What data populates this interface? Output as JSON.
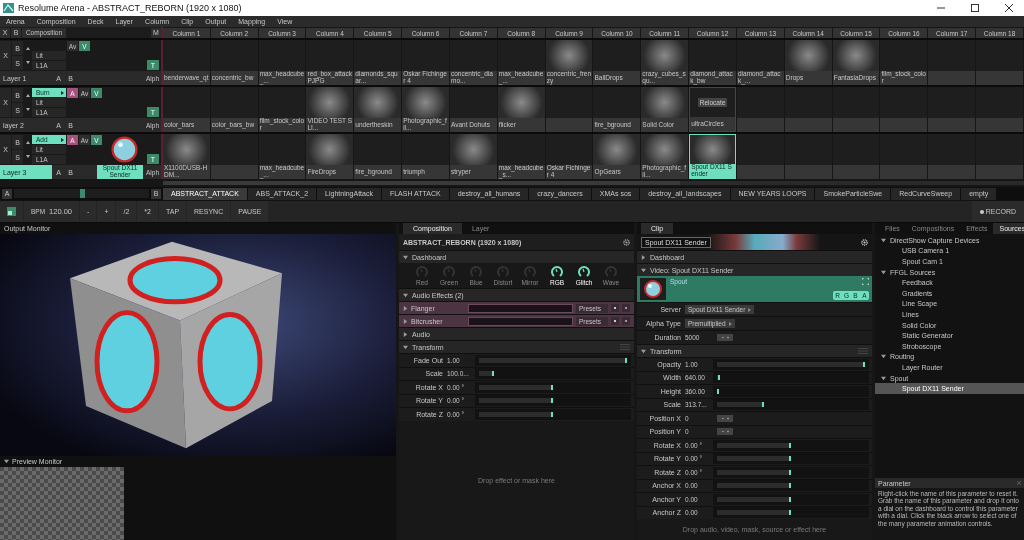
{
  "window": {
    "title": "Resolume Arena - ABSTRACT_REBORN (1920 x 1080)"
  },
  "menu": [
    "Arena",
    "Composition",
    "Deck",
    "Layer",
    "Column",
    "Clip",
    "Output",
    "Mapping",
    "View"
  ],
  "layer_header": {
    "x": "X",
    "b": "B",
    "label": "Composition",
    "m": "M"
  },
  "columns": [
    "Column 1",
    "Column 2",
    "Column 3",
    "Column 4",
    "Column 5",
    "Column 6",
    "Column 7",
    "Column 8",
    "Column 9",
    "Column 10",
    "Column 11",
    "Column 12",
    "Column 13",
    "Column 14",
    "Column 15",
    "Column 16",
    "Column 17",
    "Column 18"
  ],
  "layers": [
    {
      "name": "Layer 1",
      "selected": false,
      "x": "X",
      "b": "B",
      "s": "S",
      "modes": [
        "Lit",
        "L1A"
      ],
      "toggles": [
        {
          "label": "Av",
          "kind": "plain"
        },
        {
          "label": "V",
          "kind": "green"
        }
      ],
      "t": "T",
      "deck_a": "A",
      "deck_b": "B",
      "alpha": "Alph",
      "clips": [
        {
          "name": "benderwave_qt",
          "thumb": false,
          "selected": false,
          "missing": false
        },
        {
          "name": "concentric_bw",
          "thumb": false,
          "selected": false,
          "missing": false
        },
        {
          "name": "max_headcube_...",
          "thumb": false,
          "selected": false,
          "missing": false
        },
        {
          "name": "red_box_attackPJPG",
          "thumb": false,
          "selected": false,
          "missing": false
        },
        {
          "name": "diamonds_squar...",
          "thumb": false,
          "selected": false,
          "missing": false
        },
        {
          "name": "Oskar Fichinger 4",
          "thumb": false,
          "selected": false,
          "missing": false
        },
        {
          "name": "concentric_diamo...",
          "thumb": false,
          "selected": false,
          "missing": false
        },
        {
          "name": "max_headcube_...",
          "thumb": false,
          "selected": false,
          "missing": false
        },
        {
          "name": "concentric_frenzy",
          "thumb": true,
          "selected": false,
          "missing": false
        },
        {
          "name": "BallDrops",
          "thumb": false,
          "selected": false,
          "missing": false
        },
        {
          "name": "crazy_cubes_squ...",
          "thumb": true,
          "selected": false,
          "missing": false
        },
        {
          "name": "diamond_attack_bw",
          "thumb": false,
          "selected": false,
          "missing": false
        },
        {
          "name": "diamond_attack_...",
          "thumb": false,
          "selected": false,
          "missing": false
        },
        {
          "name": "Drops",
          "thumb": true,
          "selected": false,
          "missing": false
        },
        {
          "name": "FantasiaDrops",
          "thumb": true,
          "selected": false,
          "missing": false
        },
        {
          "name": "film_stock_color",
          "thumb": false,
          "selected": false,
          "missing": false
        },
        {
          "thumb": false,
          "selected": false,
          "missing": false
        },
        {
          "thumb": false,
          "selected": false,
          "missing": false
        }
      ]
    },
    {
      "name": "layer 2",
      "selected": false,
      "x": "X",
      "b": "B",
      "s": "S",
      "blend": "Burn",
      "modes": [
        "Lit",
        "L1A"
      ],
      "toggles": [
        {
          "label": "A",
          "kind": "pink"
        },
        {
          "label": "Av",
          "kind": "plain"
        },
        {
          "label": "V",
          "kind": "green"
        }
      ],
      "t": "T",
      "deck_a": "A",
      "deck_b": "B",
      "alpha": "Alph",
      "clips": [
        {
          "name": "color_bars",
          "thumb": false,
          "selected": false,
          "missing": false
        },
        {
          "name": "color_bars_bw",
          "thumb": false,
          "selected": false,
          "missing": false
        },
        {
          "name": "film_stock_color",
          "thumb": false,
          "selected": false,
          "missing": false
        },
        {
          "name": "VIDEO TEST SLI...",
          "thumb": true,
          "selected": false,
          "missing": false
        },
        {
          "name": "undertheskin",
          "thumb": true,
          "selected": false,
          "missing": false
        },
        {
          "name": "Photographic_fil...",
          "thumb": true,
          "selected": false,
          "missing": false
        },
        {
          "name": "Avant Dohuts",
          "thumb": false,
          "selected": false,
          "missing": false
        },
        {
          "name": "flicker",
          "thumb": true,
          "selected": false,
          "missing": false
        },
        {
          "thumb": false,
          "selected": false,
          "missing": false
        },
        {
          "name": "fire_bground",
          "thumb": false,
          "selected": false,
          "missing": false
        },
        {
          "name": "Solid Color",
          "thumb": true,
          "selected": false,
          "missing": false
        },
        {
          "name": "ultraCircles",
          "thumb": false,
          "selected": false,
          "missing": true,
          "action": "Relocate"
        },
        {
          "thumb": false,
          "selected": false,
          "missing": false
        },
        {
          "thumb": false,
          "selected": false,
          "missing": false
        },
        {
          "thumb": false,
          "selected": false,
          "missing": false
        },
        {
          "thumb": false,
          "selected": false,
          "missing": false
        },
        {
          "thumb": false,
          "selected": false,
          "missing": false
        },
        {
          "thumb": false,
          "selected": false,
          "missing": false
        }
      ]
    },
    {
      "name": "Layer 3",
      "selected": true,
      "x": "X",
      "b": "B",
      "s": "S",
      "blend": "Add",
      "modes": [
        "Lit",
        "L1A"
      ],
      "toggles": [
        {
          "label": "A",
          "kind": "pink"
        },
        {
          "label": "Av",
          "kind": "plain"
        },
        {
          "label": "V",
          "kind": "green"
        }
      ],
      "t": "T",
      "deck_a": "A",
      "deck_b": "B",
      "alpha": "Alph",
      "preview": {
        "label": "Spout DX11 Sender"
      },
      "clips": [
        {
          "name": "X1100DUSB-HDM...",
          "thumb": true,
          "selected": false,
          "missing": false
        },
        {
          "thumb": false,
          "selected": false,
          "missing": false
        },
        {
          "name": "max_headcube_...",
          "thumb": false,
          "selected": false,
          "missing": false
        },
        {
          "name": "FireDrops",
          "thumb": true,
          "selected": false,
          "missing": false
        },
        {
          "name": "fire_bground",
          "thumb": false,
          "selected": false,
          "missing": false
        },
        {
          "name": "triumph",
          "thumb": false,
          "selected": false,
          "missing": false
        },
        {
          "name": "stryper",
          "thumb": true,
          "selected": false,
          "missing": false
        },
        {
          "name": "max_headcube_s...",
          "thumb": false,
          "selected": false,
          "missing": false
        },
        {
          "name": "Oskar Fichinger 4",
          "thumb": false,
          "selected": false,
          "missing": false
        },
        {
          "name": "OpGears",
          "thumb": true,
          "selected": false,
          "missing": false
        },
        {
          "name": "Photographic_fil...",
          "thumb": true,
          "selected": false,
          "missing": false
        },
        {
          "name": "Spout DX11 Sender",
          "thumb": true,
          "selected": true,
          "missing": false
        },
        {
          "thumb": false,
          "selected": false,
          "missing": false
        },
        {
          "thumb": false,
          "selected": false,
          "missing": false
        },
        {
          "thumb": false,
          "selected": false,
          "missing": false
        },
        {
          "thumb": false,
          "selected": false,
          "missing": false
        },
        {
          "thumb": false,
          "selected": false,
          "missing": false
        },
        {
          "thumb": false,
          "selected": false,
          "missing": false
        }
      ]
    }
  ],
  "crossfader": {
    "a": "A",
    "b": "B",
    "level": 0.5
  },
  "decks": [
    {
      "label": "ABSTRACT_ATTACK",
      "selected": true
    },
    {
      "label": "ABS_ATTACK_2",
      "selected": false
    },
    {
      "label": "LightningAttack",
      "selected": false
    },
    {
      "label": "FLASH ATTACK",
      "selected": false
    },
    {
      "label": "destroy_all_humans",
      "selected": false
    },
    {
      "label": "crazy_dancers",
      "selected": false
    },
    {
      "label": "XMAs sos",
      "selected": false
    },
    {
      "label": "destroy_all_landscapes",
      "selected": false
    },
    {
      "label": "NEW YEARS LOOPS",
      "selected": false
    },
    {
      "label": "SmokeParticleSwe",
      "selected": false
    },
    {
      "label": "RedCurveSweep",
      "selected": false
    },
    {
      "label": "empty",
      "selected": false
    }
  ],
  "transport": {
    "bpm_label": "BPM",
    "bpm": "120.00",
    "buttons": [
      "-",
      "+",
      "/2",
      "*2",
      "TAP",
      "RESYNC",
      "PAUSE"
    ],
    "record": "RECORD"
  },
  "output_monitor": {
    "title": "Output Monitor"
  },
  "preview_monitor": {
    "title": "Preview Monitor"
  },
  "composition_panel": {
    "tabs": [
      {
        "label": "Composition",
        "selected": true
      },
      {
        "label": "Layer",
        "selected": false
      }
    ],
    "title": "ABSTRACT_REBORN (1920 x 1080)",
    "dashboard": {
      "label": "Dashboard",
      "expanded": true,
      "dials": [
        {
          "label": "Red",
          "on": false
        },
        {
          "label": "Green",
          "on": false
        },
        {
          "label": "Blue",
          "on": false
        },
        {
          "label": "Distort",
          "on": false
        },
        {
          "label": "Mirror",
          "on": false
        },
        {
          "label": "RGB",
          "on": true
        },
        {
          "label": "Glitch",
          "on": true
        },
        {
          "label": "Wave",
          "on": false
        }
      ]
    },
    "audio_effects": {
      "label": "Audio Effects (2)",
      "expanded": true,
      "effects": [
        {
          "name": "Flanger",
          "expanded": false,
          "presets": "Presets"
        },
        {
          "name": "Bitcrusher",
          "expanded": false,
          "presets": "Presets"
        }
      ]
    },
    "audio": {
      "label": "Audio",
      "expanded": false
    },
    "transform": {
      "label": "Transform",
      "expanded": true,
      "params": [
        {
          "label": "Fade Out",
          "value": "1.00",
          "kind": "slider",
          "level": 1.0
        },
        {
          "label": "Scale",
          "value": "100.0...",
          "kind": "slider",
          "level": 0.1
        },
        {
          "label": "Rotate X",
          "value": "0.00 °",
          "kind": "slider",
          "level": 0.5
        },
        {
          "label": "Rotate Y",
          "value": "0.00 °",
          "kind": "slider",
          "level": 0.5
        },
        {
          "label": "Rotate Z",
          "value": "0.00 °",
          "kind": "slider",
          "level": 0.5
        }
      ]
    },
    "drop_hint": "Drop effect or mask here"
  },
  "clip_panel": {
    "tabs": [
      {
        "label": "Clip",
        "selected": true
      }
    ],
    "name": "Spout DX11 Sender",
    "dashboard": {
      "label": "Dashboard",
      "expanded": false
    },
    "video": {
      "label": "Video: Spout DX11 Sender",
      "expanded": true,
      "source": "Spout",
      "channels": [
        "R",
        "G",
        "B",
        "A"
      ]
    },
    "settings": [
      {
        "label": "Server",
        "value": "Spout DX11 Sender",
        "kind": "dropdown"
      },
      {
        "label": "Alpha Type",
        "value": "Premultiplied",
        "kind": "dropdown"
      },
      {
        "label": "Duration",
        "value": "5000",
        "kind": "stepper"
      }
    ],
    "transform": {
      "label": "Transform",
      "expanded": true,
      "params": [
        {
          "label": "Opacity",
          "value": "1.00",
          "kind": "slider",
          "level": 1.0
        },
        {
          "label": "Width",
          "value": "640.00",
          "kind": "slider",
          "level": 0.02
        },
        {
          "label": "Height",
          "value": "360.00",
          "kind": "slider",
          "level": 0.01
        },
        {
          "label": "Scale",
          "value": "313.7...",
          "kind": "slider",
          "level": 0.32
        },
        {
          "label": "Position X",
          "value": "0",
          "kind": "stepper"
        },
        {
          "label": "Position Y",
          "value": "0",
          "kind": "stepper"
        },
        {
          "label": "Rotate X",
          "value": "0.00 °",
          "kind": "slider",
          "level": 0.5
        },
        {
          "label": "Rotate Y",
          "value": "0.00 °",
          "kind": "slider",
          "level": 0.5
        },
        {
          "label": "Rotate Z",
          "value": "0.00 °",
          "kind": "slider",
          "level": 0.5
        },
        {
          "label": "Anchor X",
          "value": "0.00",
          "kind": "slider",
          "level": 0.5
        },
        {
          "label": "Anchor Y",
          "value": "0.00",
          "kind": "slider",
          "level": 0.5
        },
        {
          "label": "Anchor Z",
          "value": "0.00",
          "kind": "slider",
          "level": 0.5
        }
      ]
    },
    "drop_hint": "Drop audio, video, mask, source or effect here"
  },
  "sources": {
    "tabs": [
      {
        "label": "Files",
        "selected": false
      },
      {
        "label": "Compositions",
        "selected": false
      },
      {
        "label": "Effects",
        "selected": false
      },
      {
        "label": "Sources",
        "selected": true
      }
    ],
    "tree": [
      {
        "label": "DirectShow Capture Devices",
        "expanded": true,
        "selected": false,
        "children": [
          {
            "label": "USB Camera 1",
            "selected": false
          },
          {
            "label": "Spout Cam 1",
            "selected": false
          }
        ]
      },
      {
        "label": "FFGL Sources",
        "expanded": true,
        "selected": false,
        "children": [
          {
            "label": "Feedback",
            "selected": false
          },
          {
            "label": "Gradients",
            "selected": false
          },
          {
            "label": "Line Scape",
            "selected": false
          },
          {
            "label": "Lines",
            "selected": false
          },
          {
            "label": "Solid Color",
            "selected": false
          },
          {
            "label": "Static Generator",
            "selected": false
          },
          {
            "label": "Stroboscope",
            "selected": false
          }
        ]
      },
      {
        "label": "Routing",
        "expanded": true,
        "selected": false,
        "children": [
          {
            "label": "Layer Router",
            "selected": false
          }
        ]
      },
      {
        "label": "Spout",
        "expanded": true,
        "selected": false,
        "children": [
          {
            "label": "Spout DX11 Sender",
            "selected": true
          }
        ]
      }
    ]
  },
  "parameter": {
    "title": "Parameter",
    "text": "Right-click the name of this parameter to reset it. Grab the name of this parameter and drop it onto a dial on the dashboard to control this parameter with a dial. Click the black arrow to select one of the many parameter animation controls."
  }
}
